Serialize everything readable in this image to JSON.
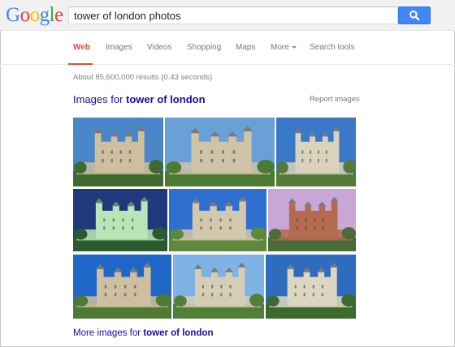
{
  "logo": {
    "letters": [
      "G",
      "o",
      "o",
      "g",
      "l",
      "e"
    ],
    "colors": [
      "#4285f4",
      "#ea4335",
      "#fbbc05",
      "#4285f4",
      "#34a853",
      "#ea4335"
    ]
  },
  "search": {
    "query": "tower of london photos",
    "button_icon": "search-icon",
    "button_color": "#4285f4"
  },
  "nav": {
    "tabs": [
      {
        "label": "Web",
        "active": true
      },
      {
        "label": "Images"
      },
      {
        "label": "Videos"
      },
      {
        "label": "Shopping"
      },
      {
        "label": "Maps"
      },
      {
        "label": "More"
      },
      {
        "label": "Search tools"
      }
    ],
    "active_color": "#dd4b39"
  },
  "results": {
    "stats": "About 85,600,000 results (0.43 seconds)"
  },
  "images_block": {
    "heading_prefix": "Images for ",
    "heading_query": "tower of london",
    "report_label": "Report images",
    "more_prefix": "More images for ",
    "more_query": "tower of london",
    "thumbnails": [
      {
        "subject": "tower-photo",
        "sky": "#4b86c8",
        "stone": "#cdbf9f",
        "ground": "#3f6a2e"
      },
      {
        "subject": "tower-photo",
        "sky": "#6aa0d8",
        "stone": "#cfc4a8",
        "ground": "#4d7a33"
      },
      {
        "subject": "tower-photo",
        "sky": "#3a78c8",
        "stone": "#d9d2bd",
        "ground": "#567a3c"
      },
      {
        "subject": "tower-night-photo",
        "sky": "#1e3a7a",
        "stone": "#b9e6b8",
        "ground": "#2a5a30"
      },
      {
        "subject": "tower-photo",
        "sky": "#2f6fd0",
        "stone": "#d3c8ad",
        "ground": "#5d8a3a"
      },
      {
        "subject": "tower-dusk-photo",
        "sky": "#c8a6d6",
        "stone": "#b36a4e",
        "ground": "#4a6b3a"
      },
      {
        "subject": "tower-photo",
        "sky": "#1f66c9",
        "stone": "#cdbfa0",
        "ground": "#4f7a35"
      },
      {
        "subject": "tower-photo",
        "sky": "#7fb3e6",
        "stone": "#d6cdb6",
        "ground": "#4f8036"
      },
      {
        "subject": "tower-photo",
        "sky": "#2f6cc0",
        "stone": "#ddd6c3",
        "ground": "#3c6a2c"
      }
    ]
  }
}
